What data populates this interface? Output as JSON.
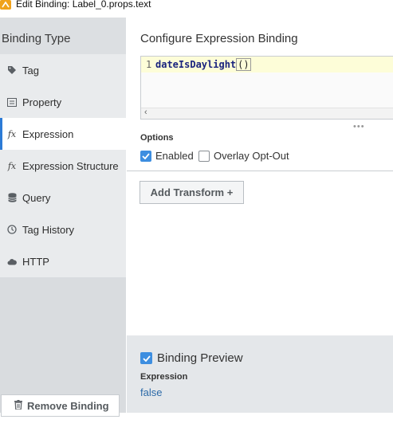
{
  "window": {
    "title": "Edit Binding: Label_0.props.text"
  },
  "sidebar": {
    "header": "Binding Type",
    "items": [
      {
        "label": "Tag",
        "icon": "tag-icon"
      },
      {
        "label": "Property",
        "icon": "property-icon"
      },
      {
        "label": "Expression",
        "icon": "fx-icon"
      },
      {
        "label": "Expression Structure",
        "icon": "fx-icon"
      },
      {
        "label": "Query",
        "icon": "database-icon"
      },
      {
        "label": "Tag History",
        "icon": "clock-icon"
      },
      {
        "label": "HTTP",
        "icon": "cloud-icon"
      }
    ],
    "active_index": 2,
    "remove_button": "Remove Binding"
  },
  "main": {
    "title": "Configure Expression Binding",
    "editor": {
      "line_number": "1",
      "code": "dateIsDaylight",
      "code_suffix": "()"
    },
    "options": {
      "label": "Options",
      "enabled": {
        "label": "Enabled",
        "checked": true
      },
      "overlay_opt_out": {
        "label": "Overlay Opt-Out",
        "checked": false
      }
    },
    "add_transform": "Add Transform +"
  },
  "preview": {
    "title": "Binding Preview",
    "checked": true,
    "expression_label": "Expression",
    "value": "false"
  },
  "colors": {
    "accent": "#2c7bd6",
    "checkbox": "#3d8ee0",
    "preview_value": "#2c6aa8"
  }
}
